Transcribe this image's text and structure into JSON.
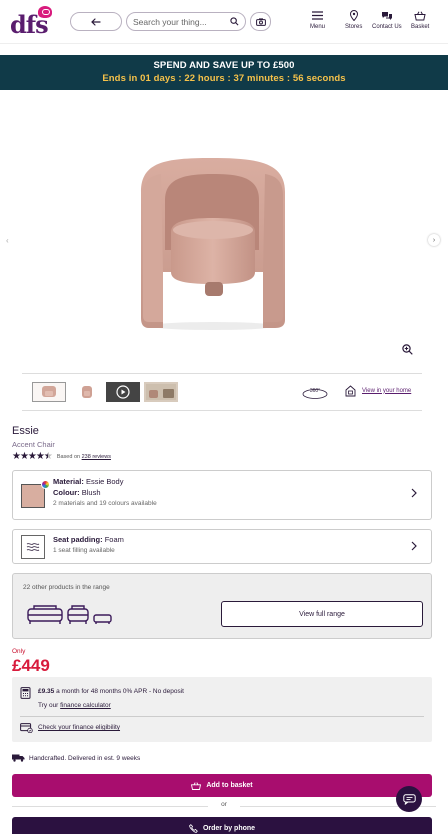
{
  "header": {
    "logo_text": "dfs",
    "search_placeholder": "Search your thing...",
    "nav": [
      {
        "label": "Menu"
      },
      {
        "label": "Stores"
      },
      {
        "label": "Contact Us"
      },
      {
        "label": "Basket"
      }
    ]
  },
  "promo": {
    "title": "SPEND AND SAVE UP TO £500",
    "countdown": "Ends in  01 days : 22 hours : 37 minutes : 56 seconds"
  },
  "gallery": {
    "view_360_label": "360°",
    "view_in_home": "View in your home"
  },
  "product": {
    "name": "Essie",
    "type": "Accent Chair",
    "rating_value": 4.5,
    "rating_prefix": "Based on",
    "review_count": "238 reviews"
  },
  "options": {
    "material": {
      "label": "Material:",
      "value": "Essie Body",
      "colour_label": "Colour:",
      "colour_value": "Blush",
      "sub": "2 materials and 19 colours available",
      "swatch_color": "#d8aea0"
    },
    "seat": {
      "label": "Seat padding:",
      "value": "Foam",
      "sub": "1 seat filling available"
    }
  },
  "range": {
    "text": "22 other products in the range",
    "button": "View full range"
  },
  "price": {
    "only": "Only",
    "amount": "£449"
  },
  "finance": {
    "monthly": "£9.35",
    "monthly_rest": " a month for 48 months 0% APR - No deposit",
    "try_prefix": "Try our ",
    "calculator_link": "finance calculator",
    "eligibility": "Check your finance eligibility"
  },
  "delivery": "Handcrafted. Delivered in est. 9 weeks",
  "actions": {
    "add_to_basket": "Add to basket",
    "or": "or",
    "order_by_phone": "Order by phone"
  },
  "colors": {
    "brand_purple": "#2b1140",
    "basket_magenta": "#a80d6e",
    "price_red": "#d81b3c",
    "promo_bg": "#103a48",
    "countdown_yellow": "#f6c24a"
  }
}
